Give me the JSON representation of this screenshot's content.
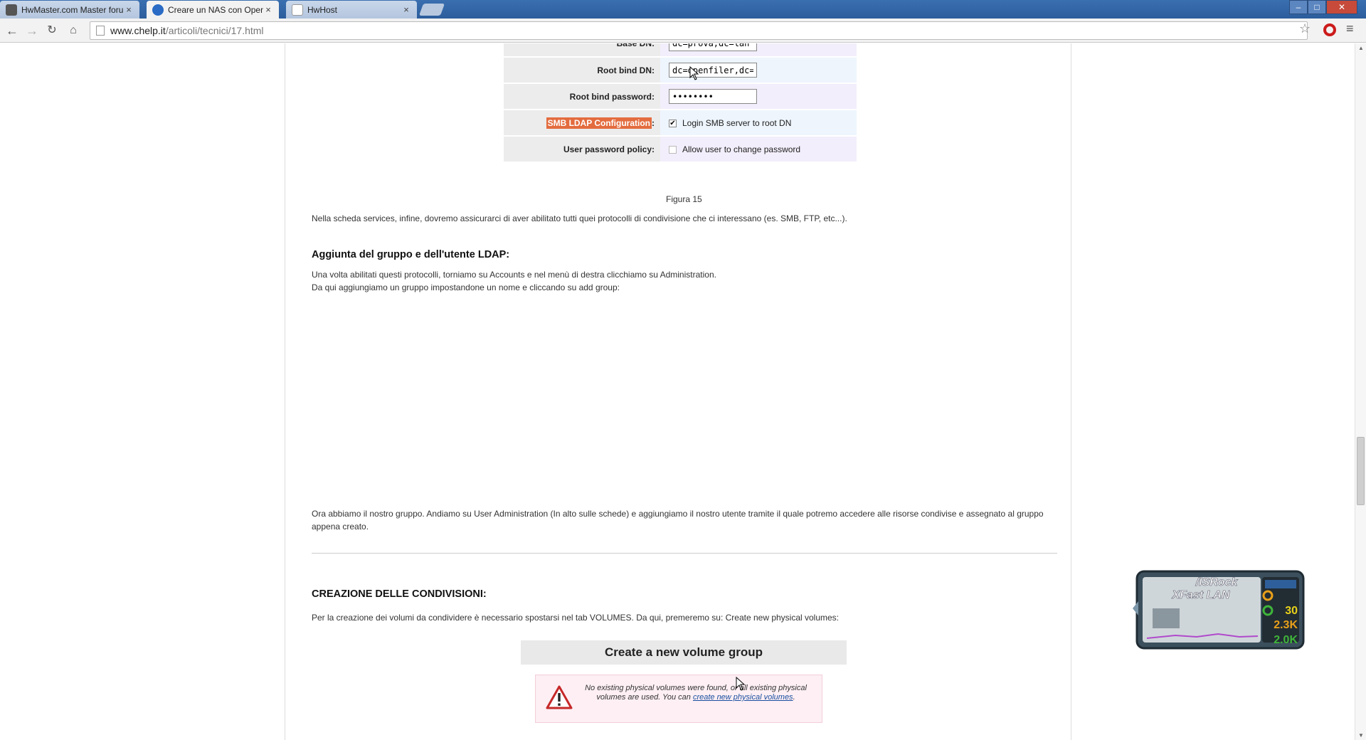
{
  "browser": {
    "tabs": [
      {
        "label": "HwMaster.com  Master forum -",
        "overlay": "HwMaster.com",
        "active": false
      },
      {
        "label": "Creare un NAS con OpenF",
        "active": true
      },
      {
        "label": "HwHost",
        "active": false
      }
    ],
    "close_glyph": "×",
    "url_domain": "www.chelp.it",
    "url_path": "/articoli/tecnici/17.html",
    "icons": {
      "back": "back-arrow-icon",
      "forward": "forward-arrow-icon",
      "reload": "reload-icon",
      "home": "home-icon",
      "star": "bookmark-star-icon",
      "menu": "menu-icon"
    }
  },
  "figure": {
    "rows": [
      {
        "label": "Base DN:",
        "value": "dc=prova,dc=lan"
      },
      {
        "label": "Root bind DN:",
        "value": "dc=openfiler,dc=pro"
      },
      {
        "label": "Root bind password:",
        "value": "••••••••"
      },
      {
        "label_highlight": "SMB LDAP Configuration",
        "label_suffix": ":",
        "checkbox_label": "Login SMB server to root DN",
        "checked": true
      },
      {
        "label": "User password policy:",
        "checkbox_label": "Allow user to change password",
        "checked": false
      }
    ],
    "caption": "Figura 15"
  },
  "article": {
    "p1": "Nella scheda services, infine, dovremo assicurarci di aver abilitato tutti quei protocolli di condivisione che ci interessano (es. SMB, FTP, etc...).",
    "h_ldap": "Aggiunta del gruppo e dell'utente LDAP:",
    "p2": "Una volta abilitati questi protocolli, torniamo su Accounts e nel menù di destra clicchiamo su Administration.",
    "p3": "Da qui aggiungiamo un gruppo impostandone un nome e cliccando su add group:",
    "p4": "Ora abbiamo il nostro gruppo. Andiamo su User Administration (In alto sulle schede) e aggiungiamo il nostro utente tramite il quale potremo accedere alle risorse condivise e assegnato al gruppo appena creato.",
    "h_cond": "CREAZIONE DELLE CONDIVISIONI:",
    "p5": "Per la creazione dei volumi da condividere è necessario spostarsi nel tab VOLUMES. Da qui, premeremo su: Create new physical volumes:",
    "vg_title": "Create a new volume group",
    "warn_text_1": "No existing physical volumes were found, or all existing physical volumes are used. You can ",
    "warn_link": "create new physical volumes",
    "warn_text_2": "."
  },
  "widget": {
    "brand": "/ISRock",
    "product": "XFast LAN",
    "values": [
      "30",
      "2.3K",
      "2.0K"
    ],
    "colors": {
      "value1": "#e8d21a",
      "value2": "#e8a01a",
      "value3": "#3fb53a"
    }
  },
  "colors": {
    "tabstrip": "#2c5d9c",
    "highlight": "#e36c3f",
    "link": "#1a4fa0"
  }
}
